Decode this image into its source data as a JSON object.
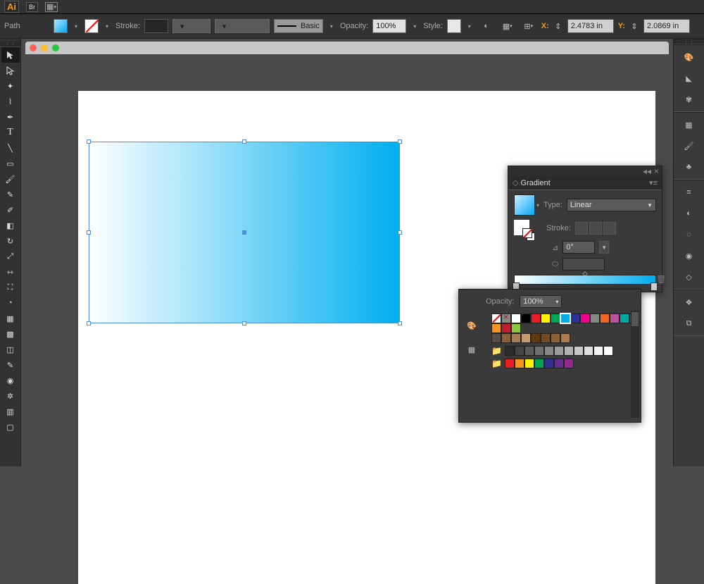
{
  "app": {
    "name": "Ai",
    "bridge": "Br"
  },
  "controlbar": {
    "selection_label": "Path",
    "stroke_label": "Stroke:",
    "stroke_weight": "",
    "brush_label": "Basic",
    "opacity_label": "Opacity:",
    "opacity_value": "100%",
    "style_label": "Style:",
    "x_label": "X:",
    "x_value": "2.4783 in",
    "y_label": "Y:",
    "y_value": "2.0869 in"
  },
  "gradient_panel": {
    "title": "Gradient",
    "type_label": "Type:",
    "type_value": "Linear",
    "stroke_label": "Stroke:",
    "angle_value": "0°",
    "location_value": ""
  },
  "swatches_panel": {
    "opacity_label": "Opacity:",
    "opacity_value": "100%",
    "row1": [
      "none",
      "reg",
      "#ffffff",
      "#000000",
      "#ed1c24",
      "#fff200",
      "#00a651",
      "#00aeef",
      "#2e3192",
      "#ec008c",
      "#868686",
      "#f26522",
      "#b9529f",
      "#00a99d",
      "#662d91",
      "#f7941d",
      "#bf1e2e",
      "#8dc63f"
    ],
    "row2": [
      "#594a42",
      "#8b5e3c",
      "#a67c52",
      "#c49a6c",
      "#603913",
      "#754c24",
      "#8c6239",
      "#a87b50"
    ],
    "grays": [
      "#2b2b2b",
      "#444444",
      "#5a5a5a",
      "#707070",
      "#868686",
      "#9c9c9c",
      "#b2b2b2",
      "#c8c8c8",
      "#dedede",
      "#f4f4f4",
      "#ffffff"
    ],
    "row3": [
      "#ed1c24",
      "#f7941d",
      "#fff200",
      "#00a651",
      "#2e3192",
      "#662d91",
      "#92278f"
    ]
  }
}
